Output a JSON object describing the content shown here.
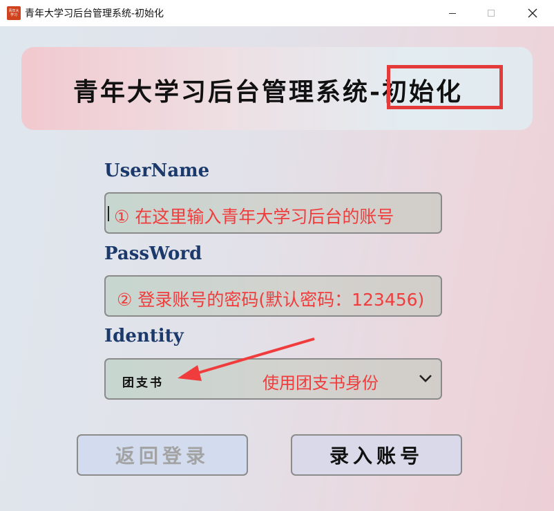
{
  "window": {
    "title": "青年大学习后台管理系统-初始化",
    "icon_text": "青年大学习"
  },
  "header": {
    "title": "青年大学习后台管理系统-初始化"
  },
  "form": {
    "username": {
      "label": "UserName",
      "hint": "① 在这里输入青年大学习后台的账号"
    },
    "password": {
      "label": "PassWord",
      "hint": "② 登录账号的密码(默认密码：123456)"
    },
    "identity": {
      "label": "Identity",
      "selected": "团支书",
      "note": "使用团支书身份"
    }
  },
  "buttons": {
    "back": "返回登录",
    "submit": "录入账号"
  },
  "colors": {
    "annotation": "#f03c3c",
    "label": "#1b3a6b",
    "highlight_border": "#e53a3a"
  }
}
